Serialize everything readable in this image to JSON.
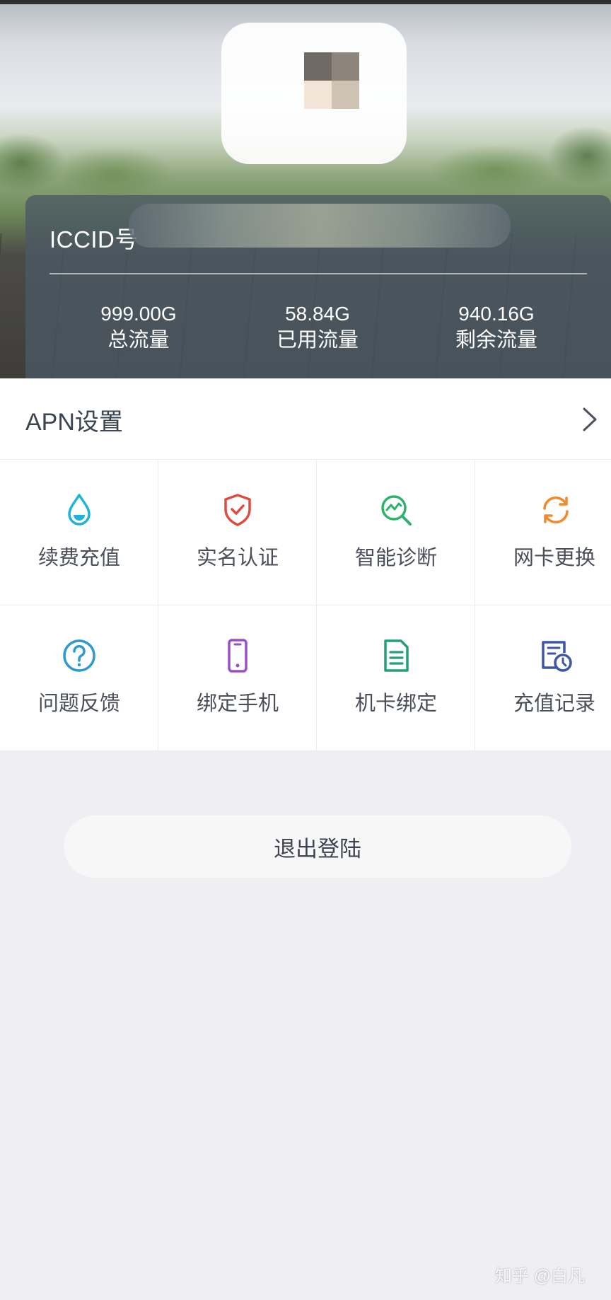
{
  "card": {
    "iccid_label": "ICCID号",
    "stats": [
      {
        "value": "999.00G",
        "label": "总流量"
      },
      {
        "value": "58.84G",
        "label": "已用流量"
      },
      {
        "value": "940.16G",
        "label": "剩余流量"
      }
    ]
  },
  "apn": {
    "label": "APN设置",
    "icon": "chevron-right-icon"
  },
  "grid": [
    {
      "label": "续费充值",
      "icon": "water-drop-icon",
      "color": "#1fb3d6"
    },
    {
      "label": "实名认证",
      "icon": "shield-check-icon",
      "color": "#e04a3f"
    },
    {
      "label": "智能诊断",
      "icon": "diagnose-search-icon",
      "color": "#2cb36a"
    },
    {
      "label": "网卡更换",
      "icon": "refresh-icon",
      "color": "#f08a2c"
    },
    {
      "label": "问题反馈",
      "icon": "question-circle-icon",
      "color": "#2f9ad1"
    },
    {
      "label": "绑定手机",
      "icon": "phone-icon",
      "color": "#9b4fc7"
    },
    {
      "label": "机卡绑定",
      "icon": "document-icon",
      "color": "#23a07a"
    },
    {
      "label": "充值记录",
      "icon": "calendar-clock-icon",
      "color": "#3d56a6"
    }
  ],
  "logout": {
    "label": "退出登陆"
  },
  "watermark": {
    "text": "知乎 @白凡"
  }
}
